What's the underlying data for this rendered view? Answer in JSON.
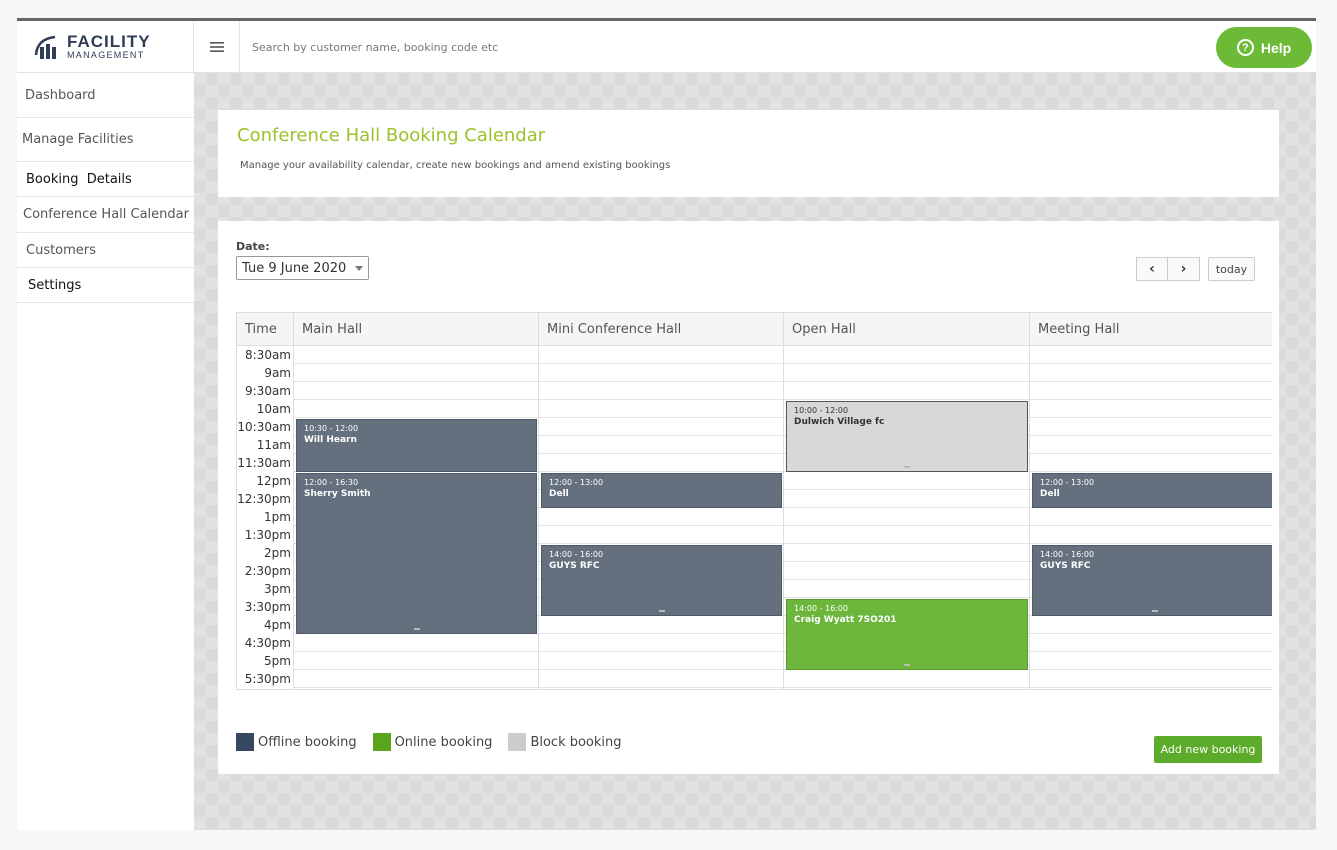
{
  "logo": {
    "line1": "FACILITY",
    "line2": "MANAGEMENT"
  },
  "topbar": {
    "search_placeholder": "Search by customer name, booking code etc",
    "help_label": "Help",
    "help_icon": "?"
  },
  "sidebar": {
    "items": [
      {
        "label": "Dashboard"
      },
      {
        "label": "Manage Facilities"
      },
      {
        "label": "Booking  Details"
      },
      {
        "label": "Conference Hall Calendar"
      },
      {
        "label": "Customers"
      },
      {
        "label": "Settings"
      }
    ]
  },
  "header": {
    "title": "Conference Hall Booking Calendar",
    "subtitle": "Manage your availability calendar, create new bookings and amend existing bookings"
  },
  "calendar": {
    "date_label": "Date:",
    "date_value": "Tue 9 June 2020",
    "prev_icon": "‹",
    "next_icon": "›",
    "today_label": "today",
    "time_header": "Time",
    "columns": [
      "Main Hall",
      "Mini Conference Hall",
      "Open Hall",
      "Meeting Hall"
    ],
    "times": [
      "8:30am",
      "9am",
      "9:30am",
      "10am",
      "10:30am",
      "11am",
      "11:30am",
      "12pm",
      "12:30pm",
      "1pm",
      "1:30pm",
      "2pm",
      "2:30pm",
      "3pm",
      "3:30pm",
      "4pm",
      "4:30pm",
      "5pm",
      "5:30pm"
    ],
    "events": [
      {
        "col": 0,
        "start": 10.5,
        "end": 12,
        "time": "10:30 - 12:00",
        "name": "Will Hearn",
        "kind": "off"
      },
      {
        "col": 0,
        "start": 12,
        "end": 16.5,
        "time": "12:00 - 16:30",
        "name": "Sherry Smith",
        "kind": "off"
      },
      {
        "col": 1,
        "start": 12,
        "end": 13,
        "time": "12:00 - 13:00",
        "name": "Dell",
        "kind": "off"
      },
      {
        "col": 1,
        "start": 14,
        "end": 16,
        "time": "14:00 - 16:00",
        "name": "GUYS RFC",
        "kind": "off"
      },
      {
        "col": 2,
        "start": 10,
        "end": 12,
        "time": "10:00 - 12:00",
        "name": "Dulwich Village fc",
        "kind": "blk"
      },
      {
        "col": 2,
        "start": 15.5,
        "end": 17.5,
        "time": "14:00 - 16:00",
        "name": "Craig Wyatt 7SO201",
        "kind": "on"
      },
      {
        "col": 3,
        "start": 12,
        "end": 13,
        "time": "12:00 - 13:00",
        "name": "Dell",
        "kind": "off"
      },
      {
        "col": 3,
        "start": 14,
        "end": 16,
        "time": "14:00 - 16:00",
        "name": "GUYS RFC",
        "kind": "off"
      }
    ]
  },
  "legend": [
    {
      "label": "Offline booking",
      "color": "#364760"
    },
    {
      "label": "Online booking",
      "color": "#5aa51c"
    },
    {
      "label": "Block booking",
      "color": "#cccccc"
    }
  ],
  "add_button_label": "Add new booking"
}
